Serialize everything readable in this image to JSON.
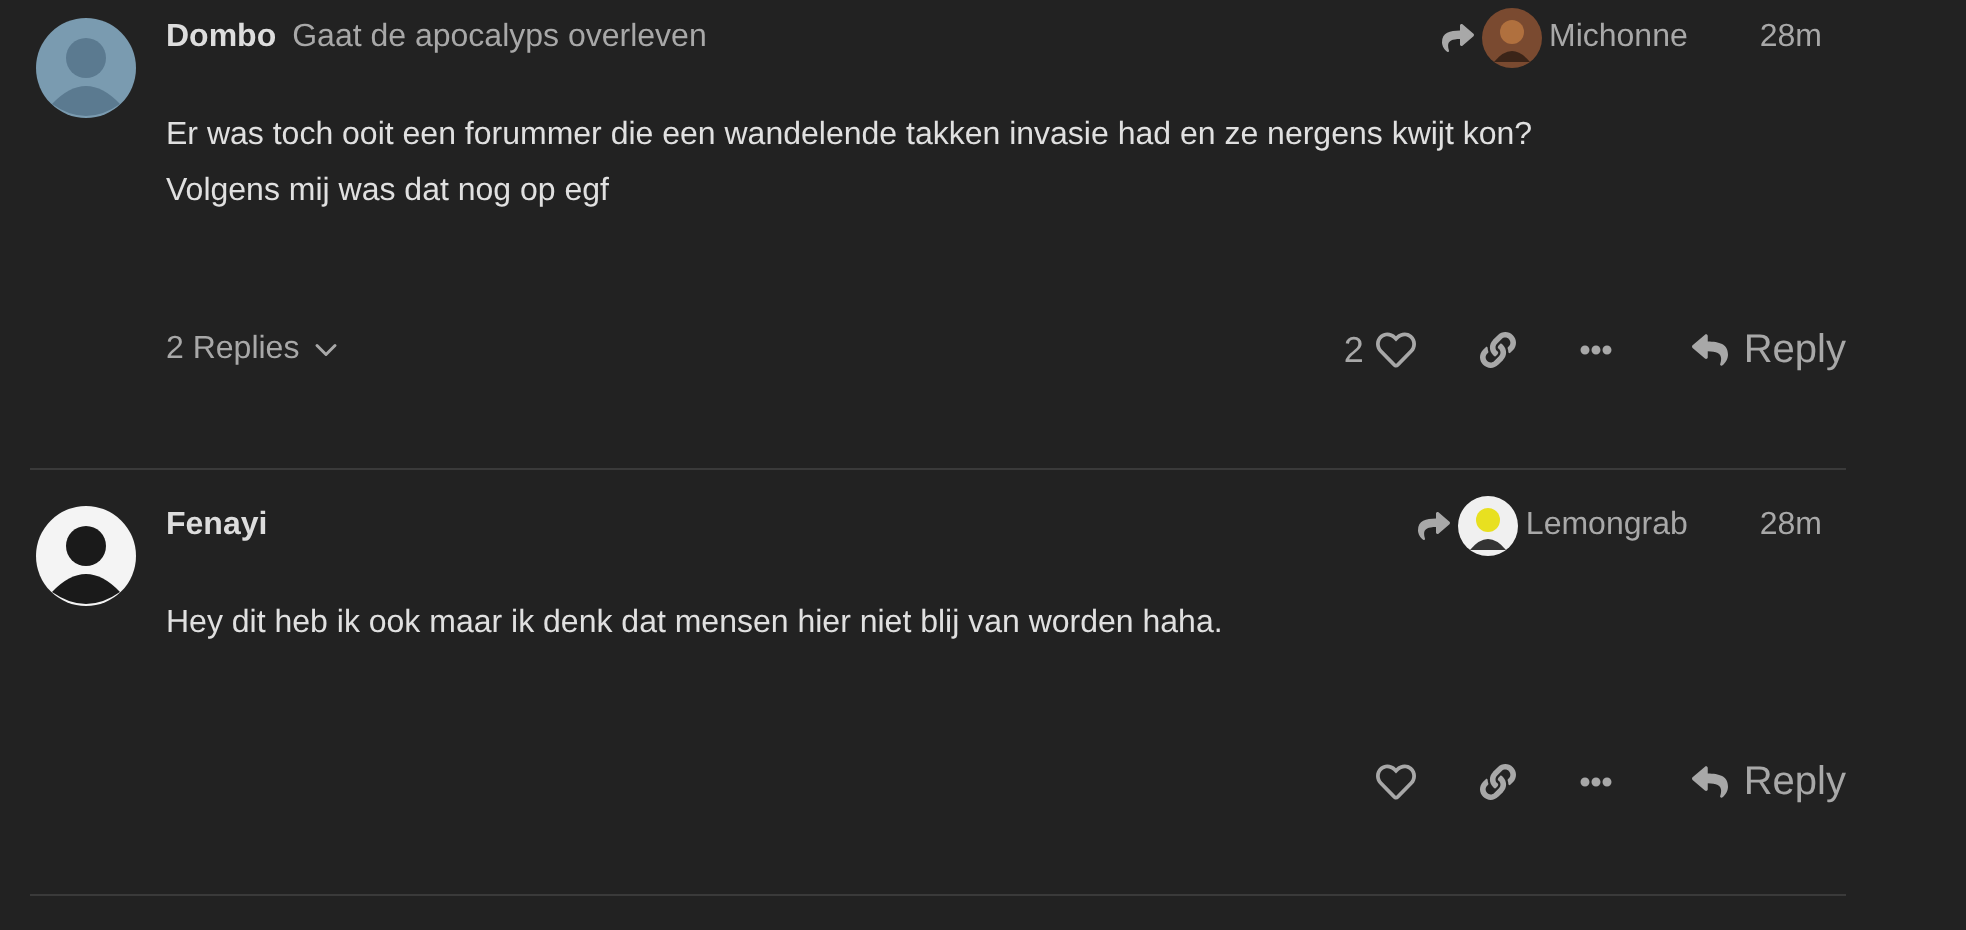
{
  "posts": [
    {
      "author": "Dombo",
      "user_title": "Gaat de apocalyps overleven",
      "reply_to": "Michonne",
      "time": "28m",
      "body": [
        "Er was toch ooit een forummer die een wandelende takken invasie had en ze nergens kwijt kon?",
        "Volgens mij was dat nog op egf"
      ],
      "replies": "2 Replies",
      "likes": "2",
      "reply_label": "Reply"
    },
    {
      "author": "Fenayi",
      "reply_to": "Lemongrab",
      "time": "28m",
      "body": [
        "Hey dit heb ik ook maar ik denk dat mensen hier niet blij van worden haha."
      ],
      "reply_label": "Reply"
    }
  ]
}
